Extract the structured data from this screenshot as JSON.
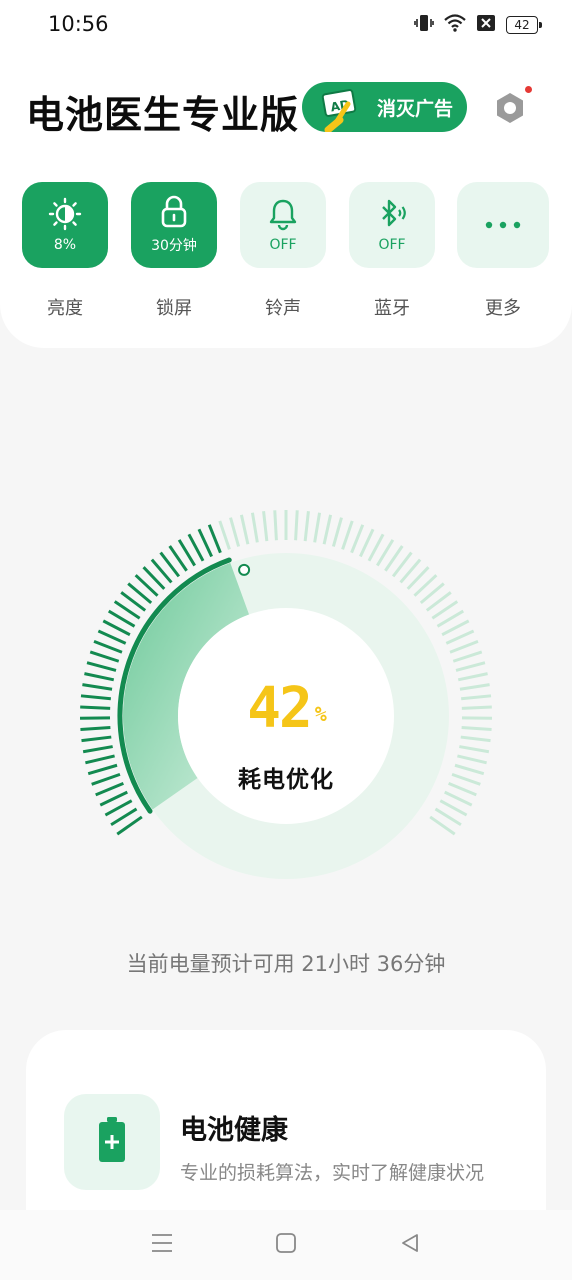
{
  "status_bar": {
    "time": "10:56",
    "battery": "42"
  },
  "header": {
    "title": "电池医生专业版",
    "ad_button": "消灭广告"
  },
  "quick_toggles": [
    {
      "label": "亮度",
      "value": "8%",
      "icon": "brightness-icon",
      "state": "on"
    },
    {
      "label": "锁屏",
      "value": "30分钟",
      "icon": "lock-icon",
      "state": "on"
    },
    {
      "label": "铃声",
      "value": "OFF",
      "icon": "bell-icon",
      "state": "off"
    },
    {
      "label": "蓝牙",
      "value": "OFF",
      "icon": "bluetooth-icon",
      "state": "off"
    },
    {
      "label": "更多",
      "value": "",
      "icon": "more-icon",
      "state": "off"
    }
  ],
  "gauge": {
    "percent": "42",
    "percent_symbol": "%",
    "label": "耗电优化",
    "level": 0.42
  },
  "estimate": "当前电量预计可用 21小时 36分钟",
  "health_card": {
    "title": "电池健康",
    "description": "专业的损耗算法，实时了解健康状况"
  },
  "colors": {
    "accent": "#1aa260",
    "accent_light": "#e8f6ef",
    "gauge_number": "#f5c518"
  }
}
